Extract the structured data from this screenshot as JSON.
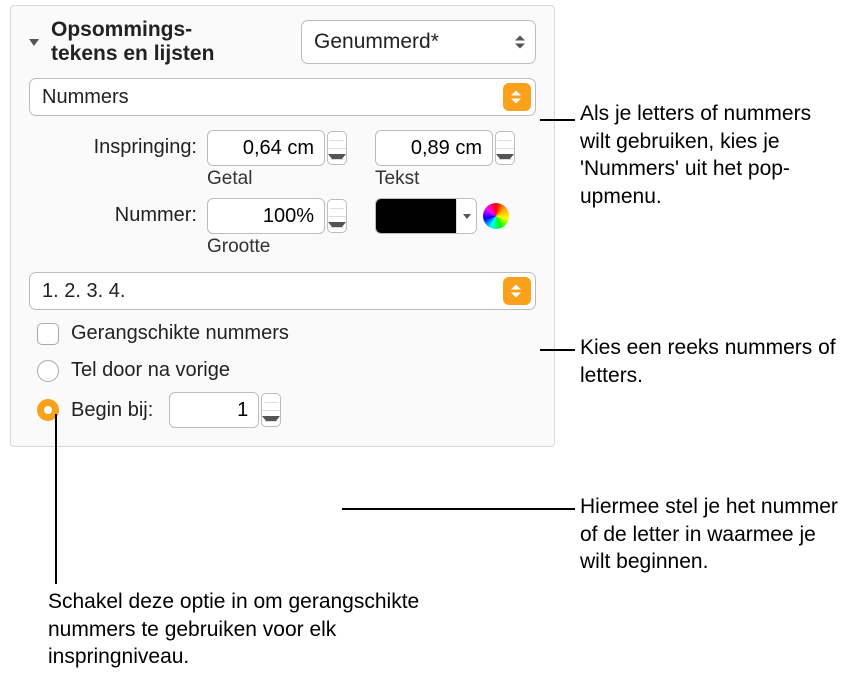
{
  "header": {
    "title": "Opsommings-\ntekens en lijsten",
    "style_label": "Genummerd*"
  },
  "type_popup": {
    "value": "Nummers"
  },
  "indent": {
    "label": "Inspringing:",
    "number_value": "0,64 cm",
    "number_caption": "Getal",
    "text_value": "0,89 cm",
    "text_caption": "Tekst"
  },
  "number": {
    "label": "Nummer:",
    "size_value": "100%",
    "size_caption": "Grootte",
    "color": "#000000"
  },
  "format_popup": {
    "value": "1. 2. 3. 4."
  },
  "tiered": {
    "label": "Gerangschikte nummers",
    "checked": false
  },
  "continue": {
    "label": "Tel door na vorige",
    "selected": false
  },
  "start": {
    "label": "Begin bij:",
    "value": "1",
    "selected": true
  },
  "callouts": {
    "c1": "Als je letters of nummers wilt gebruiken, kies je 'Nummers' uit het pop-upmenu.",
    "c2": "Kies een reeks nummers of letters.",
    "c3": "Hiermee stel je het nummer of de letter in waarmee je wilt beginnen.",
    "c4": "Schakel deze optie in om gerangschikte nummers te gebruiken voor elk inspringniveau."
  }
}
